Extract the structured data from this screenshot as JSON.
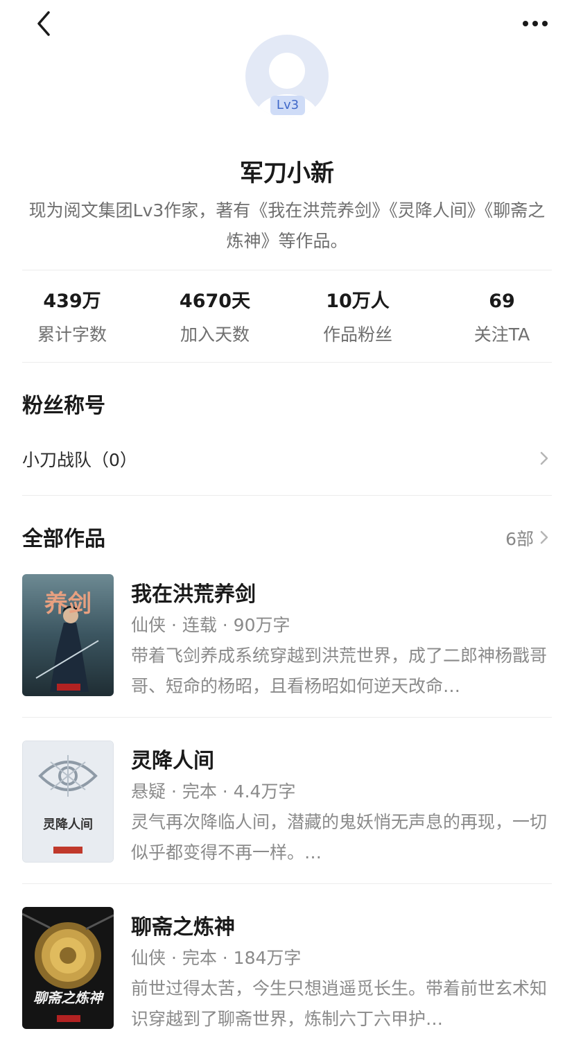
{
  "header": {
    "back_icon": "chevron-left-icon",
    "more_icon": "more-dots-icon"
  },
  "profile": {
    "level_badge": "Lv3",
    "name": "军刀小新",
    "bio": "现为阅文集团Lv3作家，著有《我在洪荒养剑》《灵降人间》《聊斋之炼神》等作品。"
  },
  "stats": [
    {
      "value": "439万",
      "label": "累计字数"
    },
    {
      "value": "4670天",
      "label": "加入天数"
    },
    {
      "value": "10万人",
      "label": "作品粉丝"
    },
    {
      "value": "69",
      "label": "关注TA"
    }
  ],
  "fan_title": {
    "heading": "粉丝称号",
    "item": "小刀战队（0）"
  },
  "works": {
    "heading": "全部作品",
    "count": "6部",
    "books": [
      {
        "title": "我在洪荒养剑",
        "meta": "仙侠 · 连载 · 90万字",
        "desc": "带着飞剑养成系统穿越到洪荒世界，成了二郎神杨戬哥哥、短命的杨昭，且看杨昭如何逆天改命…",
        "cover_text": "养剑"
      },
      {
        "title": "灵降人间",
        "meta": "悬疑 · 完本 · 4.4万字",
        "desc": "灵气再次降临人间，潜藏的鬼妖悄无声息的再现，一切似乎都变得不再一样。…",
        "cover_text": "灵降人间"
      },
      {
        "title": "聊斋之炼神",
        "meta": "仙侠 · 完本 · 184万字",
        "desc": "前世过得太苦，今生只想逍遥觅长生。带着前世玄术知识穿越到了聊斋世界，炼制六丁六甲护…",
        "cover_text": "聊斋之炼神"
      }
    ]
  },
  "colors": {
    "accent": "#3f68c8",
    "muted_text": "#8a8a8a",
    "divider": "#ececec"
  }
}
